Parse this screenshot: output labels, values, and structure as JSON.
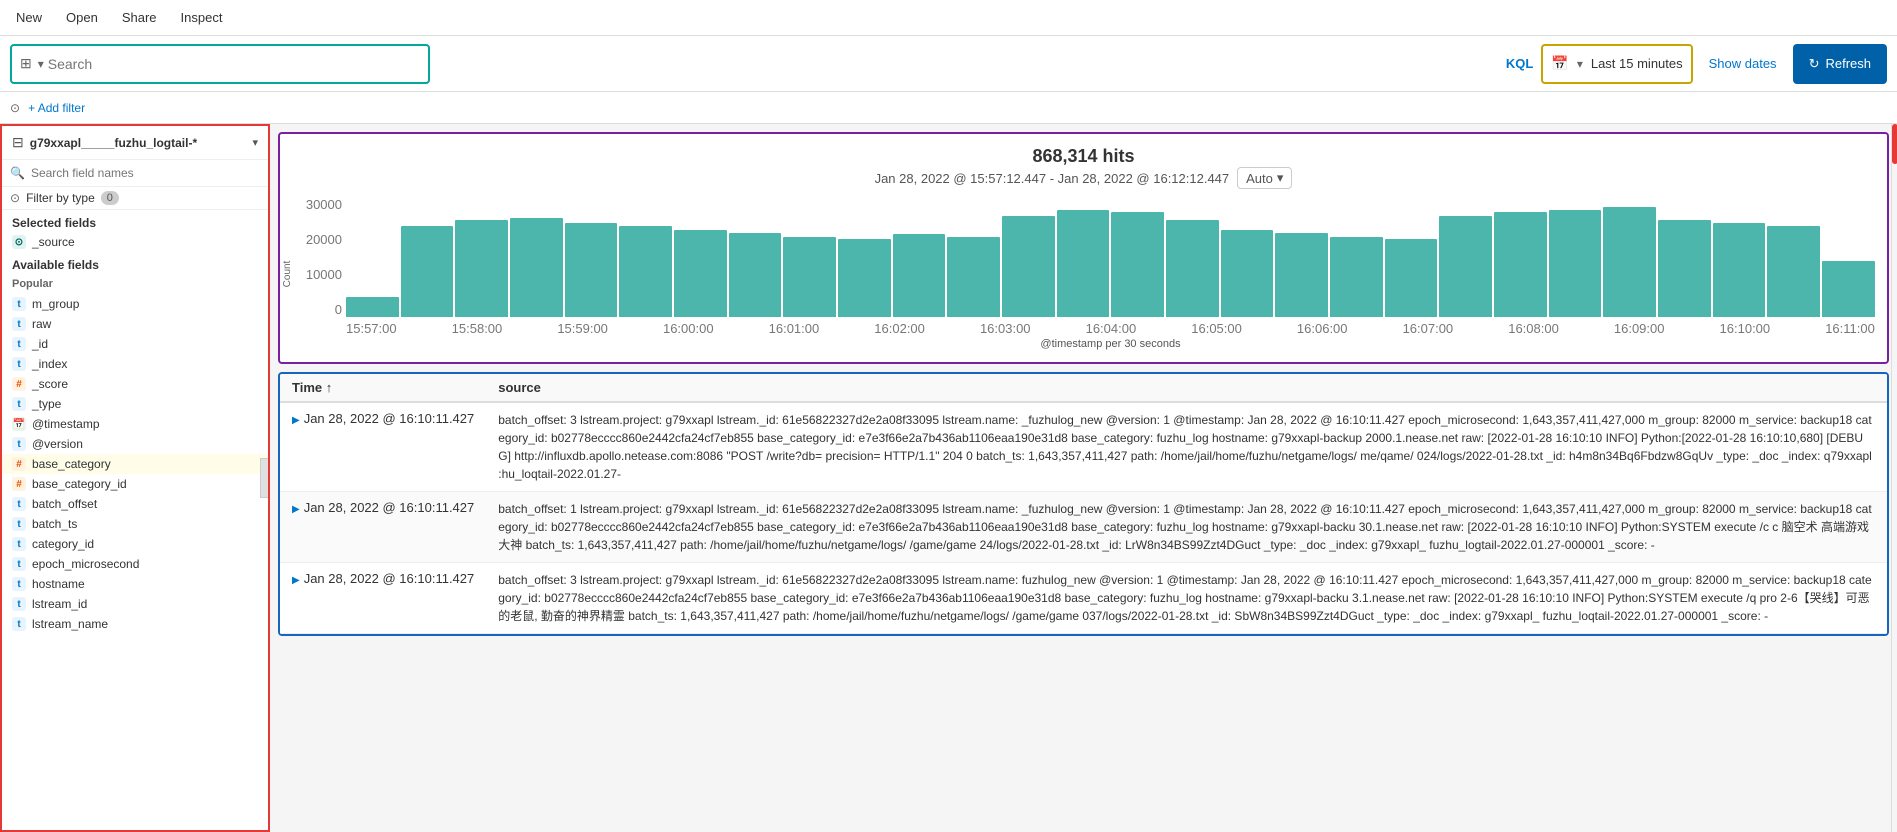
{
  "nav": {
    "items": [
      "New",
      "Open",
      "Share",
      "Inspect"
    ]
  },
  "search_bar": {
    "search_placeholder": "Search",
    "kql_label": "KQL",
    "time_picker": "Last 15 minutes",
    "show_dates_label": "Show dates",
    "refresh_label": "Refresh"
  },
  "sub_bar": {
    "add_filter_label": "+ Add filter"
  },
  "sidebar": {
    "index_name": "g79xxapl_____fuzhu_logtail-*",
    "search_placeholder": "Search field names",
    "filter_by_type_label": "Filter by type",
    "filter_badge": "0",
    "selected_fields_label": "Selected fields",
    "available_fields_label": "Available fields",
    "popular_label": "Popular",
    "selected_fields": [
      {
        "name": "_source",
        "type": "src"
      }
    ],
    "popular_fields": [
      {
        "name": "m_group",
        "type": "t"
      },
      {
        "name": "raw",
        "type": "t"
      }
    ],
    "available_fields": [
      {
        "name": "_id",
        "type": "t"
      },
      {
        "name": "_index",
        "type": "t"
      },
      {
        "name": "_score",
        "type": "hash"
      },
      {
        "name": "_type",
        "type": "t"
      },
      {
        "name": "@timestamp",
        "type": "cal"
      },
      {
        "name": "@version",
        "type": "t"
      },
      {
        "name": "base_category",
        "type": "hash"
      },
      {
        "name": "base_category_id",
        "type": "hash"
      },
      {
        "name": "batch_offset",
        "type": "t"
      },
      {
        "name": "batch_ts",
        "type": "t"
      },
      {
        "name": "category_id",
        "type": "t"
      },
      {
        "name": "epoch_microsecond",
        "type": "t"
      },
      {
        "name": "hostname",
        "type": "t"
      },
      {
        "name": "lstream_id",
        "type": "t"
      },
      {
        "name": "lstream_name",
        "type": "t"
      }
    ]
  },
  "chart": {
    "hits": "868,314 hits",
    "date_range": "Jan 28, 2022 @ 15:57:12.447 - Jan 28, 2022 @ 16:12:12.447",
    "auto_label": "Auto",
    "y_axis_label": "Count",
    "x_axis_label": "@timestamp per 30 seconds",
    "y_ticks": [
      "30000",
      "20000",
      "10000",
      "0"
    ],
    "x_ticks": [
      "15:57:00",
      "15:58:00",
      "15:59:00",
      "16:00:00",
      "16:01:00",
      "16:02:00",
      "16:03:00",
      "16:04:00",
      "16:05:00",
      "16:06:00",
      "16:07:00",
      "16:08:00",
      "16:09:00",
      "16:10:00",
      "16:11:00"
    ],
    "bars": [
      15,
      68,
      72,
      74,
      70,
      68,
      65,
      63,
      60,
      58,
      62,
      60,
      75,
      80,
      78,
      72,
      65,
      63,
      60,
      58,
      75,
      78,
      80,
      82,
      72,
      70,
      68,
      42
    ]
  },
  "results": {
    "columns": [
      "Time ↑",
      "source"
    ],
    "rows": [
      {
        "time": "Jan 28, 2022 @ 16:10:11.427",
        "source": "batch_offset: 3  lstream.project: g79xxapl  lstream._id: 61e56822327d2e2a08f33095  lstream.name:       _fuzhulog_new  @version: 1  @timestamp: Jan 28, 2022 @ 16:10:11.427  epoch_microsecond: 1,643,357,411,427,000  m_group: 82000  m_service: backup18  category_id: b02778ecccc860e2442cfa24cf7eb855  base_category_id: e7e3f66e2a7b436ab1106eaa190e31d8  base_category: fuzhu_log  hostname: g79xxapl-backup       2000.1.nease.net  raw: [2022-01-28 16:10:10 INFO] Python:[2022-01-28 16:10:10,680] [DEBUG]  http://influxdb.apollo.netease.com:8086 \"POST /write?db=      precision= HTTP/1.1\" 204 0  batch_ts: 1,643,357,411,427  path: /home/jail/home/fuzhu/netgame/logs/      me/qame/       024/logs/2022-01-28.txt  _id: h4m8n34Bq6Fbdzw8GqUv  _type: _doc  _index: q79xxapl        :hu_loqtail-2022.01.27-"
      },
      {
        "time": "Jan 28, 2022 @ 16:10:11.427",
        "source": "batch_offset: 1  lstream.project: g79xxapl  lstream._id: 61e56822327d2e2a08f33095  lstream.name:       _fuzhulog_new  @version: 1  @timestamp: Jan 28, 2022 @ 16:10:11.427  epoch_microsecond: 1,643,357,411,427,000  m_group: 82000  m_service: backup18  category_id: b02778ecccc860e2442cfa24cf7eb855  base_category_id: e7e3f66e2a7b436ab1106eaa190e31d8  base_category: fuzhu_log  hostname: g79xxapl-backu        30.1.nease.net  raw: [2022-01-28 16:10:10 INFO] Python:SYSTEM execute /c c 脑空术 高端游戏大神  batch_ts: 1,643,357,411,427  path: /home/jail/home/fuzhu/netgame/logs/      /game/game        24/logs/2022-01-28.txt  _id: LrW8n34BS99Zzt4DGuct  _type: _doc  _index: g79xxapl_        fuzhu_logtail-2022.01.27-000001  _score: -"
      },
      {
        "time": "Jan 28, 2022 @ 16:10:11.427",
        "source": "batch_offset: 3  lstream.project: g79xxapl  lstream._id: 61e56822327d2e2a08f33095  lstream.name:       fuzhulog_new  @version: 1  @timestamp: Jan 28, 2022 @ 16:10:11.427  epoch_microsecond: 1,643,357,411,427,000  m_group: 82000  m_service: backup18  category_id: b02778ecccc860e2442cfa24cf7eb855  base_category_id: e7e3f66e2a7b436ab1106eaa190e31d8  base_category: fuzhu_log  hostname: g79xxapl-backu        3.1.nease.net  raw: [2022-01-28 16:10:10 INFO] Python:SYSTEM execute /q pro 2-6【哭线】可恶的老鼠, 勤奋的神界精霊  batch_ts: 1,643,357,411,427  path: /home/jail/home/fuzhu/netgame/logs/        /game/game        037/logs/2022-01-28.txt  _id: SbW8n34BS99Zzt4DGuct  _type: _doc  _index: g79xxapl_        fuzhu_loqtail-2022.01.27-000001  _score: -"
      }
    ]
  }
}
